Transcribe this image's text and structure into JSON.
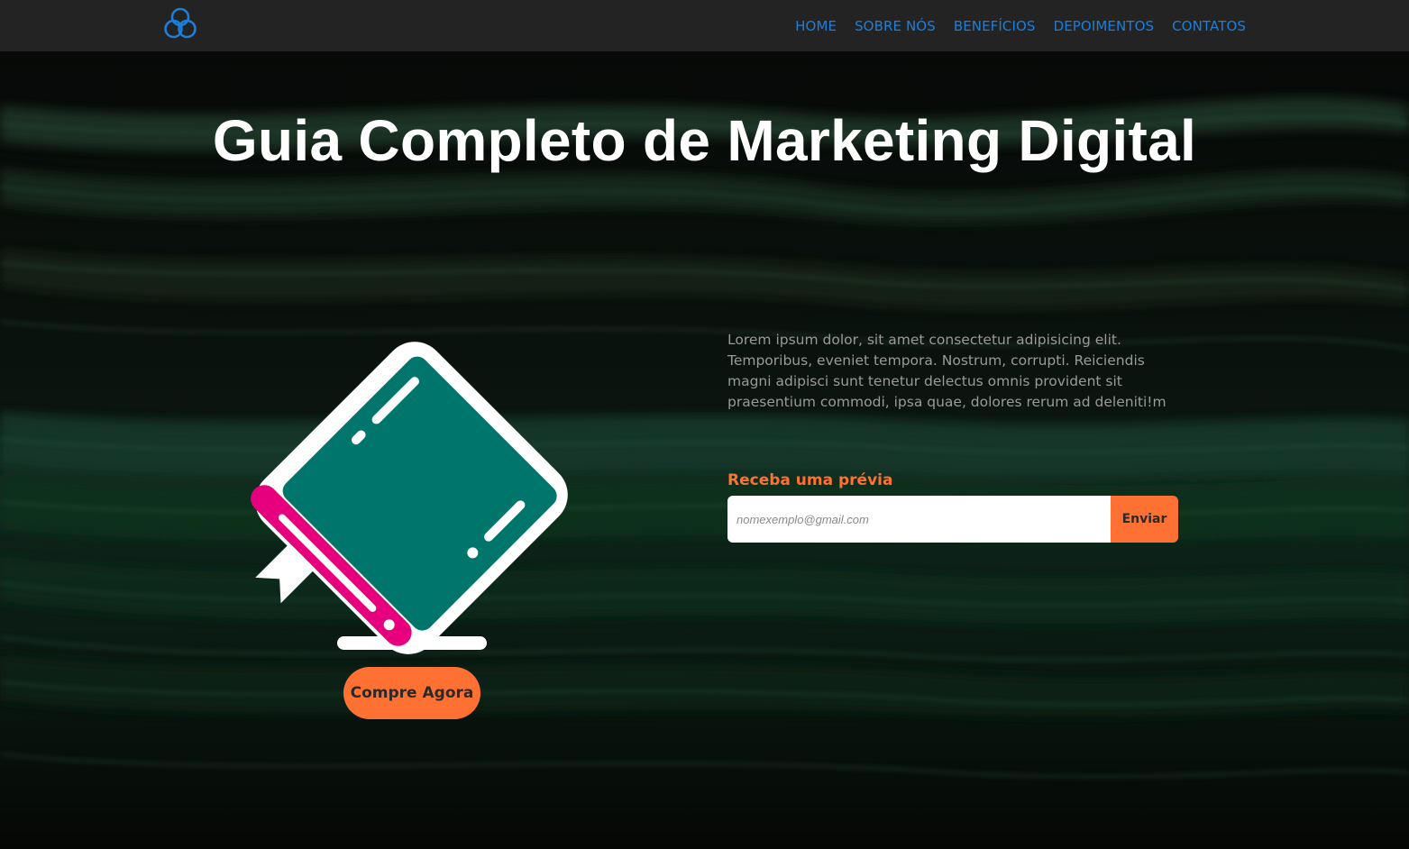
{
  "nav": {
    "logo_icon": "three-circles-logo-icon",
    "items": [
      {
        "label": "HOME"
      },
      {
        "label": "SOBRE NÓS"
      },
      {
        "label": "BENEFÍCIOS"
      },
      {
        "label": "DEPOIMENTOS"
      },
      {
        "label": "CONTATOS"
      }
    ]
  },
  "hero": {
    "title": "Guia Completo de Marketing Digital",
    "illustration_icon": "book-icon",
    "buy_label": "Compre Agora",
    "description": "Lorem ipsum dolor, sit amet consectetur adipisicing elit. Temporibus, eveniet tempora. Nostrum, corrupti. Reiciendis magni adipisci sunt tenetur delectus omnis provident sit praesentium commodi, ipsa quae, dolores rerum ad deleniti!m",
    "preview_label": "Receba uma prévia",
    "email_placeholder": "nomexemplo@gmail.com",
    "send_label": "Enviar"
  },
  "colors": {
    "accent": "#ff7133",
    "nav_link": "#1d7fd8",
    "navbar_bg": "#232323",
    "book_cover": "#00756b",
    "book_spine": "#e6007e"
  }
}
